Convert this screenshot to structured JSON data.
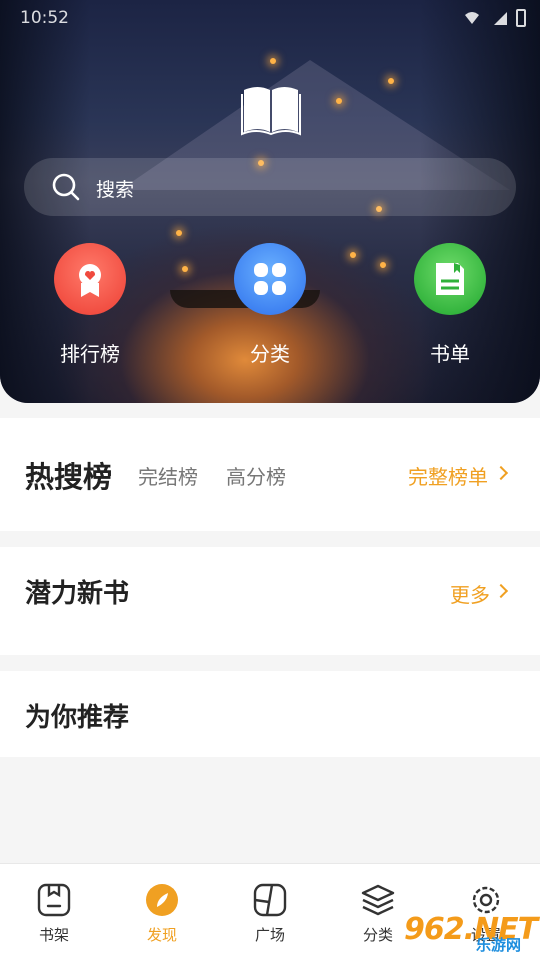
{
  "status_bar": {
    "time": "10:52"
  },
  "search": {
    "placeholder": "搜索"
  },
  "quick_actions": [
    {
      "label": "排行榜",
      "icon": "ranking-badge-icon"
    },
    {
      "label": "分类",
      "icon": "category-grid-icon"
    },
    {
      "label": "书单",
      "icon": "booklist-icon"
    }
  ],
  "hot_section": {
    "tabs": [
      "热搜榜",
      "完结榜",
      "高分榜"
    ],
    "more_label": "完整榜单"
  },
  "new_section": {
    "title": "潜力新书",
    "more_label": "更多"
  },
  "recommend_section": {
    "title": "为你推荐"
  },
  "bottom_nav": [
    {
      "label": "书架",
      "icon": "bookshelf-icon",
      "active": false
    },
    {
      "label": "发现",
      "icon": "compass-icon",
      "active": true
    },
    {
      "label": "广场",
      "icon": "plaza-icon",
      "active": false
    },
    {
      "label": "分类",
      "icon": "layers-icon",
      "active": false
    },
    {
      "label": "设置",
      "icon": "gear-icon",
      "active": false
    }
  ],
  "watermark": {
    "number": "962.NET",
    "subtitle": "乐游网"
  },
  "colors": {
    "accent": "#f0a022",
    "rank": "#f04a3e",
    "category": "#3a7df0",
    "booklist": "#2fb13a"
  }
}
